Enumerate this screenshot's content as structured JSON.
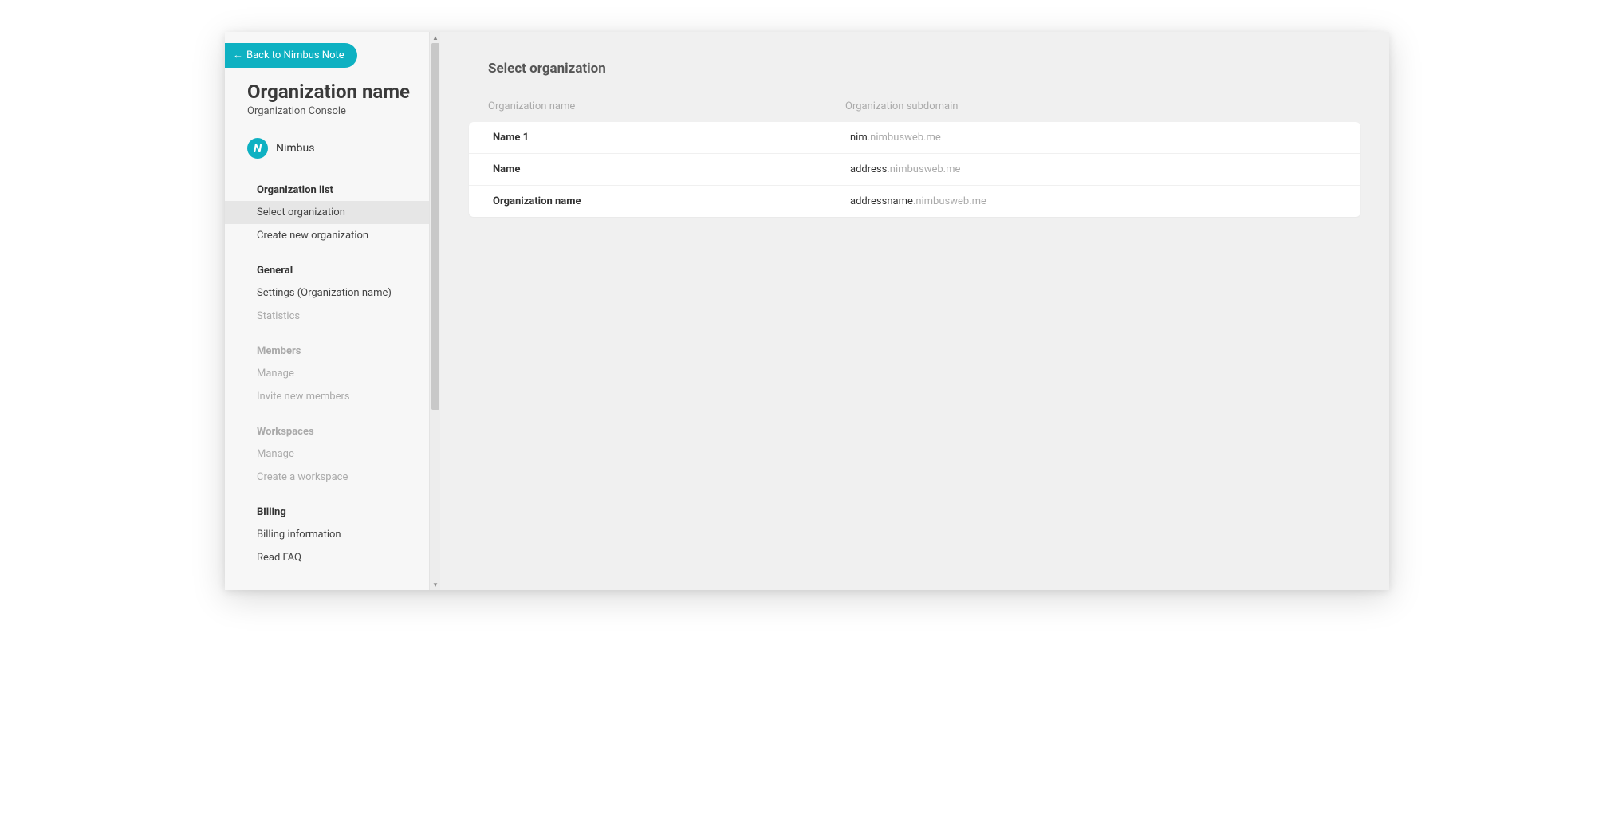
{
  "back_button": "Back to Nimbus Note",
  "sidebar": {
    "title": "Organization name",
    "subtitle": "Organization Console",
    "logo_initial": "N",
    "logo_label": "Nimbus",
    "sections": [
      {
        "heading": "Organization list",
        "muted": false,
        "items": [
          {
            "label": "Select organization",
            "selected": true,
            "muted": false
          },
          {
            "label": "Create new organization",
            "selected": false,
            "muted": false
          }
        ]
      },
      {
        "heading": "General",
        "muted": false,
        "items": [
          {
            "label": "Settings (Organization name)",
            "selected": false,
            "muted": false
          },
          {
            "label": "Statistics",
            "selected": false,
            "muted": true
          }
        ]
      },
      {
        "heading": "Members",
        "muted": true,
        "items": [
          {
            "label": "Manage",
            "selected": false,
            "muted": true
          },
          {
            "label": "Invite new members",
            "selected": false,
            "muted": true
          }
        ]
      },
      {
        "heading": "Workspaces",
        "muted": true,
        "items": [
          {
            "label": "Manage",
            "selected": false,
            "muted": true
          },
          {
            "label": "Create a workspace",
            "selected": false,
            "muted": true
          }
        ]
      },
      {
        "heading": "Billing",
        "muted": false,
        "items": [
          {
            "label": "Billing information",
            "selected": false,
            "muted": false
          },
          {
            "label": "Read FAQ",
            "selected": false,
            "muted": false
          }
        ]
      }
    ]
  },
  "main": {
    "page_title": "Select organization",
    "columns": {
      "name": "Organization name",
      "subdomain": "Organization subdomain"
    },
    "domain_suffix": ".nimbusweb.me",
    "rows": [
      {
        "name": "Name 1",
        "subdomain_prefix": "nim"
      },
      {
        "name": "Name",
        "subdomain_prefix": "address"
      },
      {
        "name": "Organization name",
        "subdomain_prefix": "addressname"
      }
    ]
  }
}
